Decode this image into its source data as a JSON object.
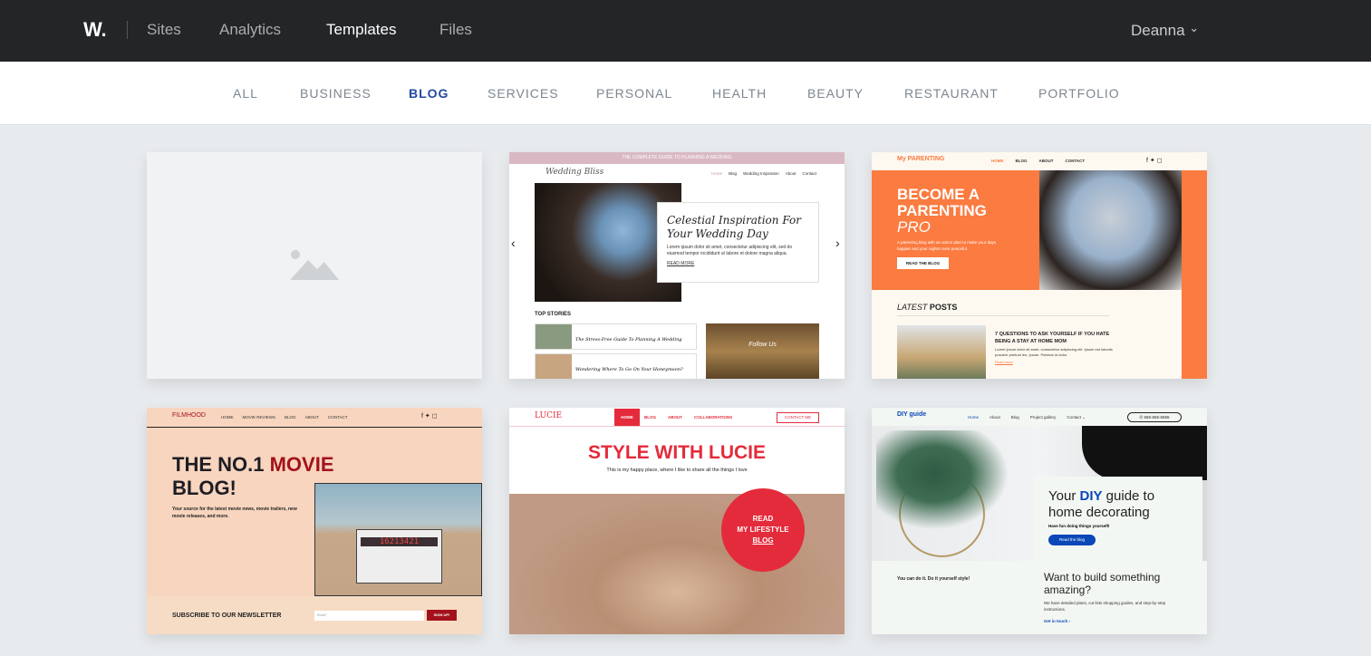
{
  "header": {
    "logo": "W.",
    "nav": [
      "Sites",
      "Analytics",
      "Templates",
      "Files"
    ],
    "active": "Templates",
    "user": "Deanna",
    "user_chevron": "⌄"
  },
  "categories": {
    "items": [
      "ALL",
      "BUSINESS",
      "BLOG",
      "SERVICES",
      "PERSONAL",
      "HEALTH",
      "BEAUTY",
      "RESTAURANT",
      "PORTFOLIO"
    ],
    "active": "BLOG"
  },
  "templates": {
    "blank": {
      "icon": "image-placeholder-icon"
    },
    "wedding": {
      "banner": "THE COMPLETE GUIDE TO PLANNING A WEDDING",
      "logo": "Wedding Bliss",
      "nav": [
        "Home",
        "Blog",
        "Wedding Inspiration",
        "About",
        "Contact"
      ],
      "title": "Celestial Inspiration For Your Wedding Day",
      "body": "Lorem ipsum dolor sit amet, consectetur adipiscing elit, sed do eiusmod tempor incididunt ut labore et dolore magna aliqua.",
      "more": "READ MORE",
      "top": "TOP STORIES",
      "story1": "The Stress-Free Guide To Planning A Wedding",
      "story2": "Wondering Where To Go On Your Honeymoon?",
      "follow": "Follow Us",
      "prev": "‹",
      "next": "›"
    },
    "parenting": {
      "logo": "My PARENTING",
      "nav": [
        "HOME",
        "BLOG",
        "ABOUT",
        "CONTACT"
      ],
      "h1": "BECOME A PARENTING",
      "h2": "PRO",
      "sub": "A parenting blog with an action plan to make your days happier and your nights more peaceful.",
      "btn": "READ THE BLOG",
      "latest1": "LATEST",
      "latest2": "POSTS",
      "post": "7 QUESTIONS TO ASK YOURSELF IF YOU HATE BEING A STAY AT HOME MOM",
      "post_body": "Lorem ipsum dolor sit amet, consectetur adipiscing elit. Ipsum est lobortis posuere pretium leo, ipsum. Pulvinar id dolor.",
      "read": "Read more"
    },
    "film": {
      "logo": "FILMHOOD",
      "nav": [
        "HOME",
        "MOVIE REVIEWS",
        "BLOG",
        "ABOUT",
        "CONTACT"
      ],
      "h1a": "THE NO.1",
      "h1b": "MOVIE",
      "h1c": "BLOG!",
      "sub": "Your source for the latest movie news, movie trailers, new movie releases, and more.",
      "news": "SUBSCRIBE TO OUR NEWSLETTER",
      "email": "Email*",
      "btn": "SIGN UP!",
      "slate": "16213421"
    },
    "lucie": {
      "logo": "LUCIE",
      "nav": [
        "HOME",
        "BLOG",
        "ABOUT",
        "COLLABORATIONS"
      ],
      "contact": "CONTACT ME",
      "title": "STYLE WITH LUCIE",
      "sub": "This is my happy place, where I like to share all the things I love",
      "c1": "READ",
      "c2": "MY LIFESTYLE",
      "c3": "BLOG"
    },
    "diy": {
      "logo": "DIY guide",
      "nav": [
        "Home",
        "About",
        "Blog",
        "Project gallery",
        "Contact ⌄"
      ],
      "phone": "555-555-5555",
      "h1a": "Your",
      "h1b": "DIY",
      "h1c": "guide to home decorating",
      "sub": "Have fun doing things yourself!",
      "btn": "Read the blog",
      "left": "You can do it. Do it yourself style!",
      "h2": "Want to build something amazing?",
      "body": "We have detailed plans, cut lists shopping guides, and step-by-step instructions.",
      "link": "Get in touch  ›"
    }
  },
  "colors": {
    "header_bg": "#232527",
    "accent": "#2449a0",
    "orange": "#fb7b40",
    "red": "#e42b3b",
    "film_red": "#a3121c",
    "diy_blue": "#0a47b8"
  }
}
